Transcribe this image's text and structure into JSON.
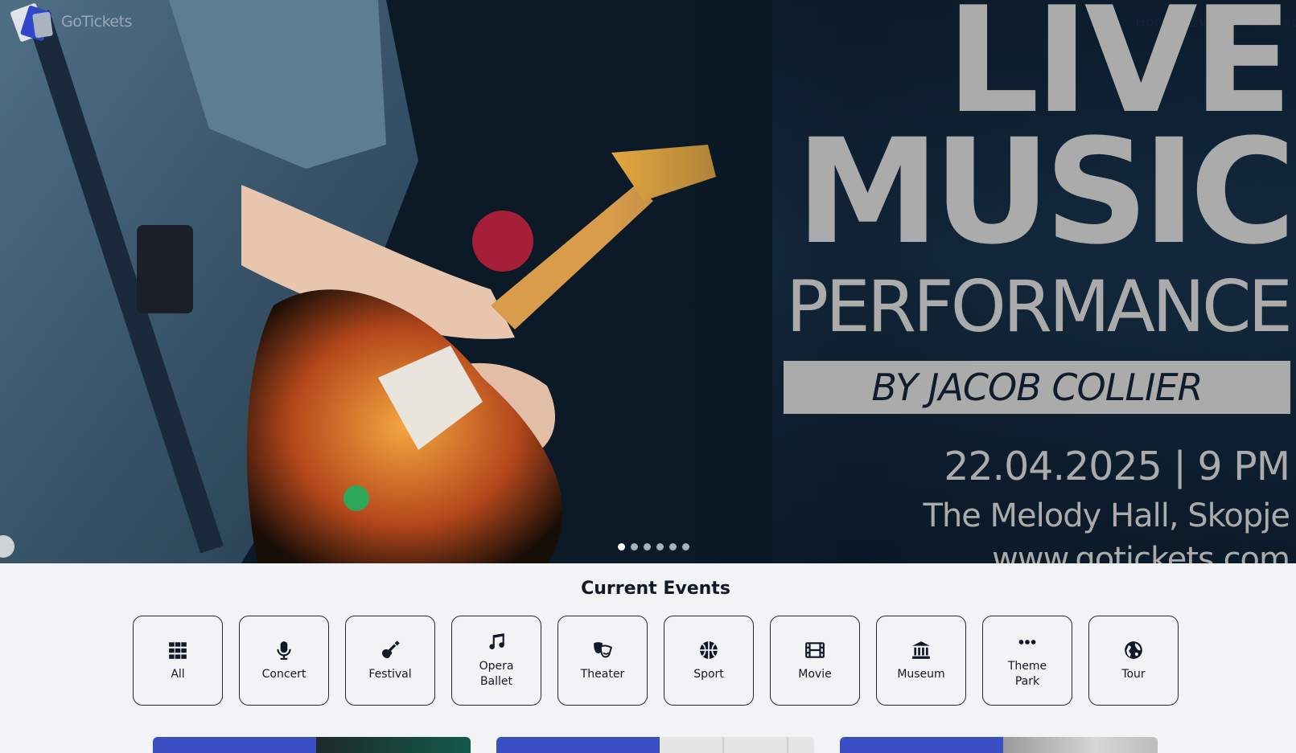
{
  "brand": {
    "name": "GoTickets",
    "logo_icon": "ticket-logo-icon"
  },
  "nav": {
    "theme_toggle_icon": "moon-icon",
    "links": [
      "Home",
      "Events",
      "Contact"
    ]
  },
  "hero": {
    "line1": "LIVE",
    "line2": "MUSIC",
    "line3": "PERFORMANCE",
    "artist": "BY JACOB COLLIER",
    "datetime": "22.04.2025 | 9 PM",
    "venue": "The Melody Hall, Skopje",
    "website": "www.gotickets.com",
    "slides_total": 6,
    "slide_active": 1
  },
  "events": {
    "title": "Current Events",
    "categories": [
      {
        "label": "All",
        "icon": "grid-icon"
      },
      {
        "label": "Concert",
        "icon": "microphone-icon"
      },
      {
        "label": "Festival",
        "icon": "guitar-icon"
      },
      {
        "label": "Opera Ballet",
        "icon": "music-note-icon"
      },
      {
        "label": "Theater",
        "icon": "theater-masks-icon"
      },
      {
        "label": "Sport",
        "icon": "basketball-icon"
      },
      {
        "label": "Movie",
        "icon": "film-icon"
      },
      {
        "label": "Museum",
        "icon": "museum-icon"
      },
      {
        "label": "Theme Park",
        "icon": "more-icon"
      },
      {
        "label": "Tour",
        "icon": "globe-icon"
      }
    ]
  },
  "colors": {
    "accent": "#3b4fc4",
    "hero_text": "#ababab",
    "nav_text": "#132236"
  }
}
